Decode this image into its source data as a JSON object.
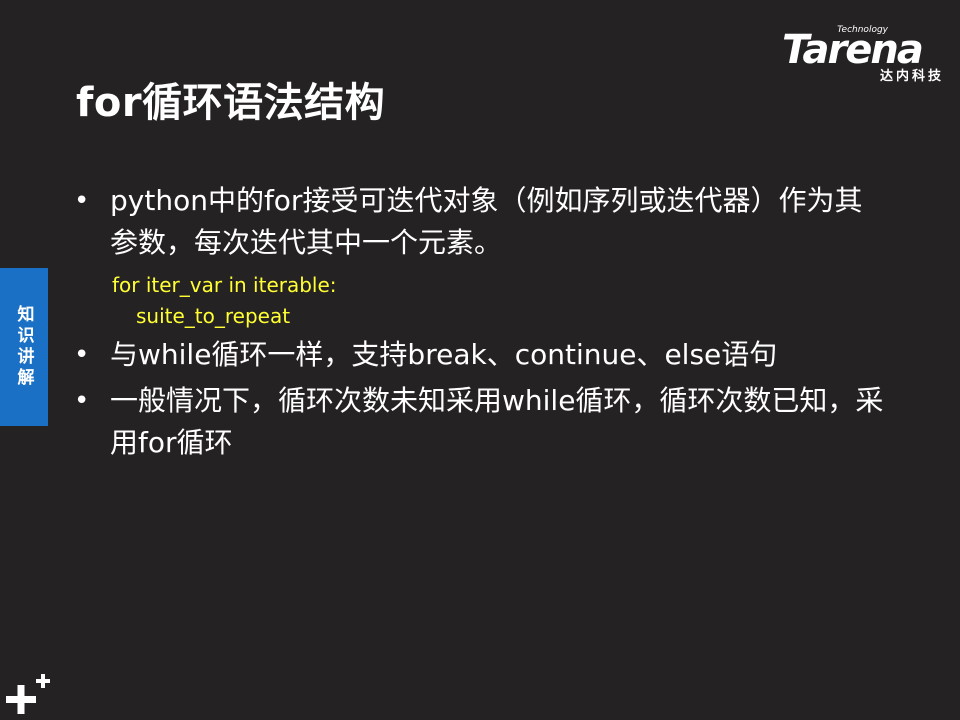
{
  "title": "for循环语法结构",
  "logo": {
    "technology": "Technology",
    "wordmark": "Tarena",
    "chinese": "达内科技"
  },
  "side_tab": {
    "label": "知识讲解"
  },
  "bullets": [
    {
      "text": "python中的for接受可迭代对象（例如序列或迭代器）作为其参数，每次迭代其中一个元素。"
    },
    {
      "text": "与while循环一样，支持break、continue、else语句"
    },
    {
      "text": "一般情况下，循环次数未知采用while循环，循环次数已知，采用for循环"
    }
  ],
  "code": {
    "line1": "for iter_var in iterable:",
    "line2": "suite_to_repeat"
  },
  "bullet_symbol": "•",
  "colors": {
    "background": "#252223",
    "code": "#ffff33",
    "side_tab": "#1a70c4"
  }
}
